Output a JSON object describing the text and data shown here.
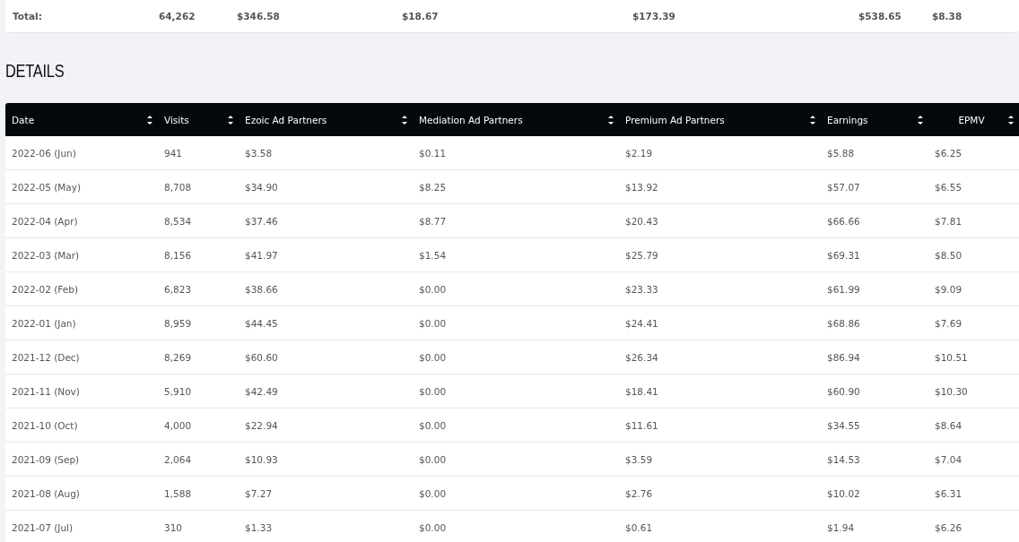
{
  "totals": {
    "label": "Total:",
    "values": [
      "64,262",
      "$346.58",
      "$18.67",
      "$173.39",
      "$538.65",
      "$8.38"
    ]
  },
  "section_title": "DETAILS",
  "table": {
    "columns": [
      "Date",
      "Visits",
      "Ezoic Ad Partners",
      "Mediation Ad Partners",
      "Premium Ad Partners",
      "Earnings",
      "EPMV"
    ],
    "rows": [
      [
        "2022-06 (Jun)",
        "941",
        "$3.58",
        "$0.11",
        "$2.19",
        "$5.88",
        "$6.25"
      ],
      [
        "2022-05 (May)",
        "8,708",
        "$34.90",
        "$8.25",
        "$13.92",
        "$57.07",
        "$6.55"
      ],
      [
        "2022-04 (Apr)",
        "8,534",
        "$37.46",
        "$8.77",
        "$20.43",
        "$66.66",
        "$7.81"
      ],
      [
        "2022-03 (Mar)",
        "8,156",
        "$41.97",
        "$1.54",
        "$25.79",
        "$69.31",
        "$8.50"
      ],
      [
        "2022-02 (Feb)",
        "6,823",
        "$38.66",
        "$0.00",
        "$23.33",
        "$61.99",
        "$9.09"
      ],
      [
        "2022-01 (Jan)",
        "8,959",
        "$44.45",
        "$0.00",
        "$24.41",
        "$68.86",
        "$7.69"
      ],
      [
        "2021-12 (Dec)",
        "8,269",
        "$60.60",
        "$0.00",
        "$26.34",
        "$86.94",
        "$10.51"
      ],
      [
        "2021-11 (Nov)",
        "5,910",
        "$42.49",
        "$0.00",
        "$18.41",
        "$60.90",
        "$10.30"
      ],
      [
        "2021-10 (Oct)",
        "4,000",
        "$22.94",
        "$0.00",
        "$11.61",
        "$34.55",
        "$8.64"
      ],
      [
        "2021-09 (Sep)",
        "2,064",
        "$10.93",
        "$0.00",
        "$3.59",
        "$14.53",
        "$7.04"
      ],
      [
        "2021-08 (Aug)",
        "1,588",
        "$7.27",
        "$0.00",
        "$2.76",
        "$10.02",
        "$6.31"
      ],
      [
        "2021-07 (Jul)",
        "310",
        "$1.33",
        "$0.00",
        "$0.61",
        "$1.94",
        "$6.26"
      ]
    ]
  }
}
